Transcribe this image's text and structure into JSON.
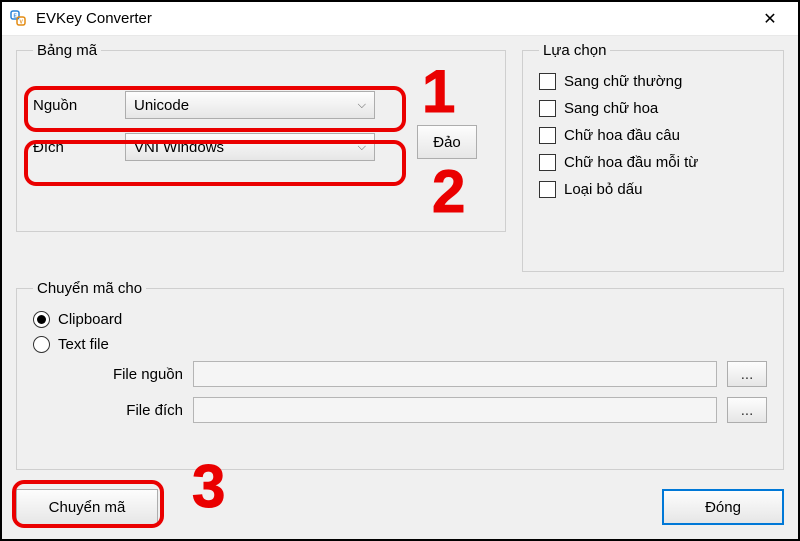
{
  "window": {
    "title": "EVKey Converter",
    "close_symbol": "✕"
  },
  "bangma": {
    "legend": "Bảng mã",
    "source_label": "Nguồn",
    "source_value": "Unicode",
    "dest_label": "Đích",
    "dest_value": "VNI Windows",
    "swap_button": "Đảo"
  },
  "luachon": {
    "legend": "Lựa chọn",
    "options": [
      "Sang chữ thường",
      "Sang chữ hoa",
      "Chữ hoa đầu câu",
      "Chữ hoa đầu mỗi từ",
      "Loại bỏ dấu"
    ]
  },
  "chuyenma": {
    "legend": "Chuyển mã cho",
    "radio_clipboard": "Clipboard",
    "radio_textfile": "Text file",
    "file_source_label": "File nguồn",
    "file_dest_label": "File đích",
    "browse_symbol": "..."
  },
  "buttons": {
    "convert": "Chuyển mã",
    "close": "Đóng"
  },
  "annotations": {
    "n1": "1",
    "n2": "2",
    "n3": "3"
  }
}
